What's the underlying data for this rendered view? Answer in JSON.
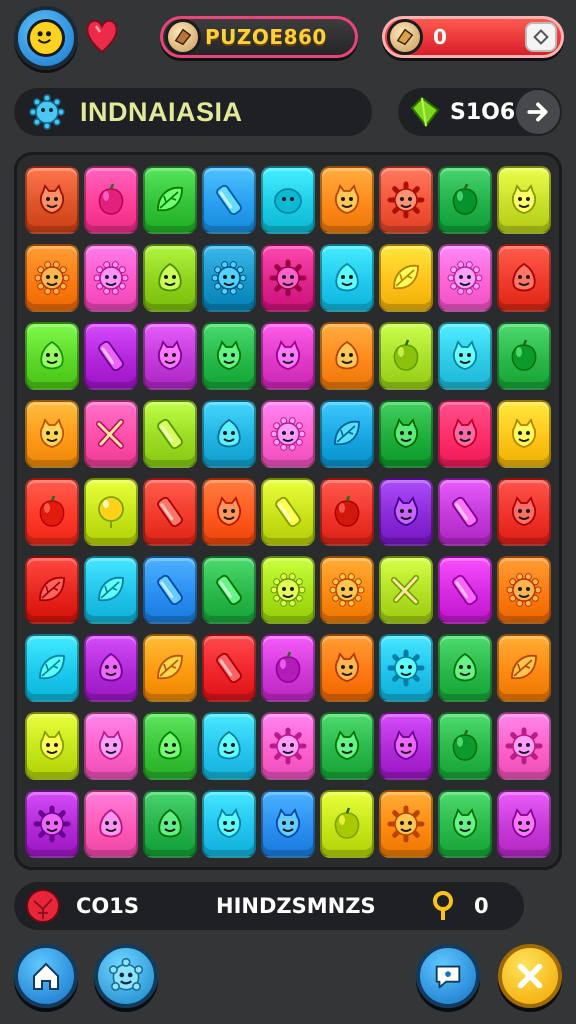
{
  "header": {
    "score": "PUZOE860",
    "coins": "0"
  },
  "level": {
    "name": "INDNAIASIA",
    "gems": "S1O6"
  },
  "status": {
    "coins_label": "CO1S",
    "mode_label": "HINDZSMNZS",
    "key_count": "0"
  },
  "icons": {
    "avatar": "sun-face-icon",
    "heart": "heart-icon",
    "score_badge": "bread-icon",
    "coins_badge": "bread-icon",
    "coins_add": "gem-outline-icon",
    "level": "virus-monster-icon",
    "gems": "green-gem-icon",
    "next": "arrow-right-icon",
    "status_orb": "red-orb-icon",
    "key": "key-icon",
    "home": "home-icon",
    "pet": "blue-monster-icon",
    "chat": "chat-icon",
    "close": "close-icon"
  },
  "board": {
    "columns": 9,
    "tiles": [
      {
        "color": "#e0542a",
        "icon": "creature"
      },
      {
        "color": "#ff3f9a",
        "icon": "fruit"
      },
      {
        "color": "#34c238",
        "icon": "leaf"
      },
      {
        "color": "#2a9ff0",
        "icon": "candy"
      },
      {
        "color": "#20cde8",
        "icon": "blob"
      },
      {
        "color": "#ff8a1c",
        "icon": "creature"
      },
      {
        "color": "#f4563a",
        "icon": "star-creature"
      },
      {
        "color": "#23b24a",
        "icon": "fruit"
      },
      {
        "color": "#c8e02a",
        "icon": "creature"
      },
      {
        "color": "#ff7b12",
        "icon": "sun"
      },
      {
        "color": "#ff58c8",
        "icon": "sun"
      },
      {
        "color": "#8ed21e",
        "icon": "face"
      },
      {
        "color": "#1896c9",
        "icon": "sun"
      },
      {
        "color": "#e0258e",
        "icon": "star-creature"
      },
      {
        "color": "#22c9ee",
        "icon": "face"
      },
      {
        "color": "#ffc31a",
        "icon": "leaf"
      },
      {
        "color": "#ff65d6",
        "icon": "sun"
      },
      {
        "color": "#f03a2a",
        "icon": "face"
      },
      {
        "color": "#5cd928",
        "icon": "face"
      },
      {
        "color": "#b227d9",
        "icon": "candy"
      },
      {
        "color": "#c23bd8",
        "icon": "creature"
      },
      {
        "color": "#27b84a",
        "icon": "creature"
      },
      {
        "color": "#e03ac8",
        "icon": "creature"
      },
      {
        "color": "#ff8a1c",
        "icon": "face"
      },
      {
        "color": "#a8e02a",
        "icon": "fruit"
      },
      {
        "color": "#2fcbe8",
        "icon": "creature"
      },
      {
        "color": "#2ab84a",
        "icon": "fruit"
      },
      {
        "color": "#ff9a1a",
        "icon": "creature"
      },
      {
        "color": "#ff4fa8",
        "icon": "tools"
      },
      {
        "color": "#9bdc24",
        "icon": "candy"
      },
      {
        "color": "#22b3e0",
        "icon": "face"
      },
      {
        "color": "#ff62cf",
        "icon": "sun"
      },
      {
        "color": "#1aa6e0",
        "icon": "leaf"
      },
      {
        "color": "#1fae3c",
        "icon": "creature"
      },
      {
        "color": "#ff2d6a",
        "icon": "creature"
      },
      {
        "color": "#ffc61a",
        "icon": "creature"
      },
      {
        "color": "#ff3a2a",
        "icon": "fruit"
      },
      {
        "color": "#c6e61a",
        "icon": "balloon"
      },
      {
        "color": "#f23a2a",
        "icon": "candy"
      },
      {
        "color": "#ff5a1e",
        "icon": "creature"
      },
      {
        "color": "#c9e21a",
        "icon": "candy"
      },
      {
        "color": "#f0362a",
        "icon": "fruit"
      },
      {
        "color": "#8a2ad8",
        "icon": "creature"
      },
      {
        "color": "#c43ad8",
        "icon": "candy"
      },
      {
        "color": "#f0322a",
        "icon": "creature"
      },
      {
        "color": "#e8261e",
        "icon": "leaf"
      },
      {
        "color": "#22c4ea",
        "icon": "leaf"
      },
      {
        "color": "#2a8ff0",
        "icon": "candy"
      },
      {
        "color": "#2ab84a",
        "icon": "candy"
      },
      {
        "color": "#a8e21a",
        "icon": "sun"
      },
      {
        "color": "#ff8a12",
        "icon": "sun"
      },
      {
        "color": "#b2e024",
        "icon": "tools"
      },
      {
        "color": "#d52ae0",
        "icon": "candy"
      },
      {
        "color": "#ff7a12",
        "icon": "sun"
      },
      {
        "color": "#1ec9ee",
        "icon": "leaf"
      },
      {
        "color": "#b02ad8",
        "icon": "face"
      },
      {
        "color": "#ff9a12",
        "icon": "leaf"
      },
      {
        "color": "#f0262a",
        "icon": "candy"
      },
      {
        "color": "#d23ad8",
        "icon": "fruit"
      },
      {
        "color": "#ff7a12",
        "icon": "creature"
      },
      {
        "color": "#22c4ee",
        "icon": "star-creature"
      },
      {
        "color": "#2ab84a",
        "icon": "face"
      },
      {
        "color": "#ff8a12",
        "icon": "leaf"
      },
      {
        "color": "#c6e61a",
        "icon": "creature"
      },
      {
        "color": "#ff62c8",
        "icon": "creature"
      },
      {
        "color": "#3ac43a",
        "icon": "face"
      },
      {
        "color": "#26c6ee",
        "icon": "face"
      },
      {
        "color": "#ff62cf",
        "icon": "star-creature"
      },
      {
        "color": "#2ab84a",
        "icon": "creature"
      },
      {
        "color": "#b02ad8",
        "icon": "creature"
      },
      {
        "color": "#2ab84a",
        "icon": "fruit"
      },
      {
        "color": "#ff62c8",
        "icon": "star-creature"
      },
      {
        "color": "#b22ad8",
        "icon": "star-creature"
      },
      {
        "color": "#ff5ab8",
        "icon": "face"
      },
      {
        "color": "#26b24a",
        "icon": "face"
      },
      {
        "color": "#22c4ee",
        "icon": "creature"
      },
      {
        "color": "#2a8ff0",
        "icon": "creature"
      },
      {
        "color": "#c6e61a",
        "icon": "fruit"
      },
      {
        "color": "#ff8a12",
        "icon": "star-creature"
      },
      {
        "color": "#2ab84a",
        "icon": "creature"
      },
      {
        "color": "#c83ad8",
        "icon": "creature"
      }
    ]
  }
}
